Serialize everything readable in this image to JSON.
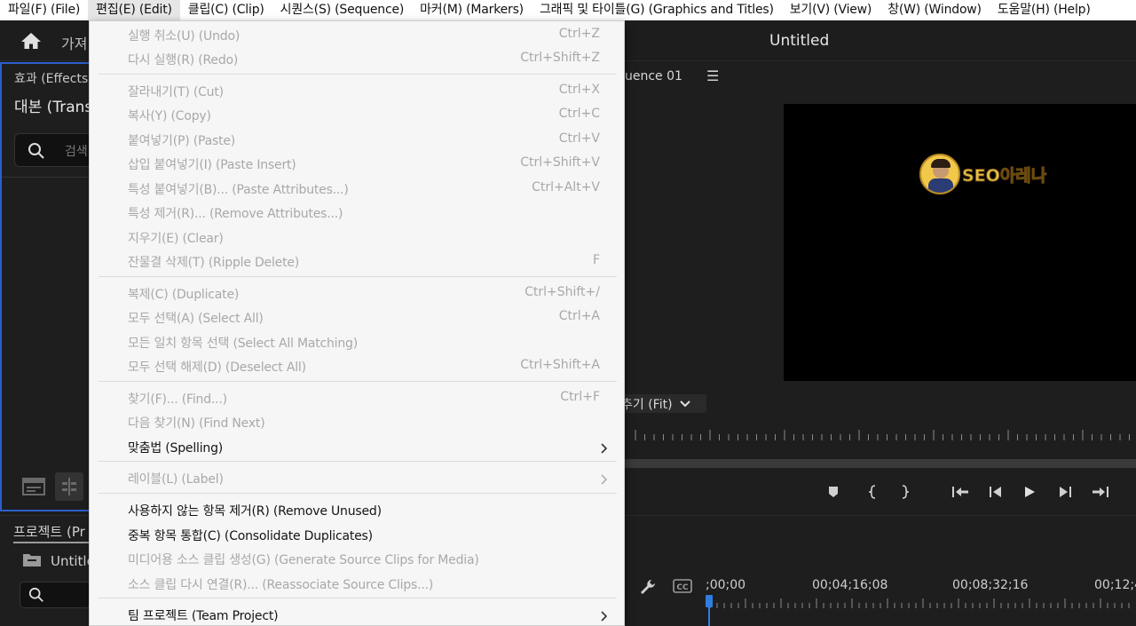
{
  "menubar": {
    "items": [
      {
        "label": "파일(F) (File)"
      },
      {
        "label": "편집(E) (Edit)"
      },
      {
        "label": "클립(C) (Clip)"
      },
      {
        "label": "시퀀스(S) (Sequence)"
      },
      {
        "label": "마커(M) (Markers)"
      },
      {
        "label": "그래픽 및 타이틀(G) (Graphics and Titles)"
      },
      {
        "label": "보기(V) (View)"
      },
      {
        "label": "창(W) (Window)"
      },
      {
        "label": "도움말(H) (Help)"
      }
    ]
  },
  "header": {
    "tab_label": "가져",
    "title": "Untitled"
  },
  "effects_panel": {
    "title": "효과 (Effects)",
    "tab": "대본 (Transc",
    "search_placeholder": "검색"
  },
  "project_panel": {
    "title": "프로젝트 (Pr",
    "item": "Untitle"
  },
  "monitor": {
    "tab": "uence 01",
    "menu_icon": "☰",
    "watermark": "SEO아레나",
    "fit_label": "추기 (Fit)"
  },
  "timeline": {
    "timecodes": [
      ";00;00",
      "00;04;16;08",
      "00;08;32;16",
      "00;12;4"
    ]
  },
  "edit_menu": {
    "items": [
      {
        "label": "실행 취소(U) (Undo)",
        "shortcut": "Ctrl+Z",
        "enabled": false
      },
      {
        "label": "다시 실행(R) (Redo)",
        "shortcut": "Ctrl+Shift+Z",
        "enabled": false
      },
      {
        "label": "잘라내기(T) (Cut)",
        "shortcut": "Ctrl+X",
        "enabled": false
      },
      {
        "label": "복사(Y) (Copy)",
        "shortcut": "Ctrl+C",
        "enabled": false
      },
      {
        "label": "붙여넣기(P) (Paste)",
        "shortcut": "Ctrl+V",
        "enabled": false
      },
      {
        "label": "삽입 붙여넣기(I) (Paste Insert)",
        "shortcut": "Ctrl+Shift+V",
        "enabled": false
      },
      {
        "label": "특성 붙여넣기(B)... (Paste Attributes...)",
        "shortcut": "Ctrl+Alt+V",
        "enabled": false
      },
      {
        "label": "특성 제거(R)... (Remove Attributes...)",
        "shortcut": "",
        "enabled": false
      },
      {
        "label": "지우기(E) (Clear)",
        "shortcut": "",
        "enabled": false
      },
      {
        "label": "잔물결 삭제(T) (Ripple Delete)",
        "shortcut": "F",
        "enabled": false
      },
      {
        "label": "복제(C) (Duplicate)",
        "shortcut": "Ctrl+Shift+/",
        "enabled": false
      },
      {
        "label": "모두 선택(A) (Select All)",
        "shortcut": "Ctrl+A",
        "enabled": false
      },
      {
        "label": "모든 일치 항목 선택 (Select All Matching)",
        "shortcut": "",
        "enabled": false
      },
      {
        "label": "모두 선택 해제(D) (Deselect All)",
        "shortcut": "Ctrl+Shift+A",
        "enabled": false
      },
      {
        "label": "찾기(F)... (Find...)",
        "shortcut": "Ctrl+F",
        "enabled": false
      },
      {
        "label": "다음 찾기(N) (Find Next)",
        "shortcut": "",
        "enabled": false
      },
      {
        "label": "맞춤법 (Spelling)",
        "shortcut": "",
        "enabled": true
      },
      {
        "label": "레이블(L) (Label)",
        "shortcut": "",
        "enabled": false
      },
      {
        "label": "사용하지 않는 항목 제거(R) (Remove Unused)",
        "shortcut": "",
        "enabled": true
      },
      {
        "label": "중복 항목 통합(C) (Consolidate Duplicates)",
        "shortcut": "",
        "enabled": true
      },
      {
        "label": "미디어용 소스 클립 생성(G) (Generate Source Clips for Media)",
        "shortcut": "",
        "enabled": false
      },
      {
        "label": "소스 클립 다시 연결(R)... (Reassociate Source Clips...)",
        "shortcut": "",
        "enabled": false
      },
      {
        "label": "팀 프로젝트 (Team Project)",
        "shortcut": "",
        "enabled": true
      }
    ]
  }
}
